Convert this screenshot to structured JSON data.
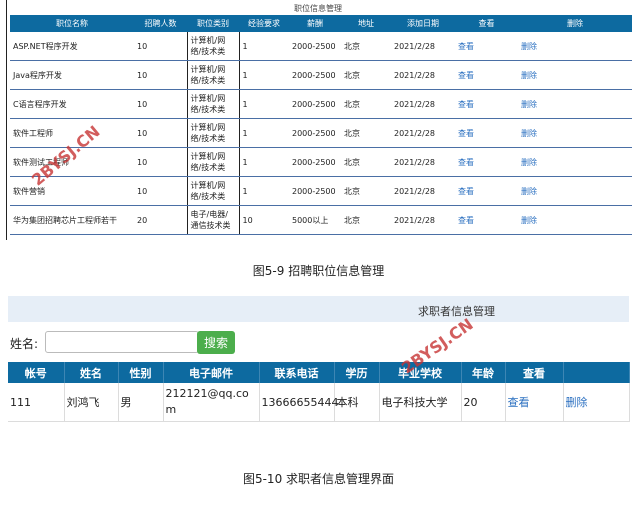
{
  "jobs": {
    "title": "职位信息管理",
    "headers": [
      "职位名称",
      "招聘人数",
      "职位类别",
      "经验要求",
      "薪酬",
      "地址",
      "添加日期",
      "查看",
      "删除"
    ],
    "rows": [
      [
        "ASP.NET程序开发",
        "10",
        "计算机/网络/技术类",
        "1",
        "2000-2500",
        "北京",
        "2021/2/28",
        "查看",
        "删除"
      ],
      [
        "Java程序开发",
        "10",
        "计算机/网络/技术类",
        "1",
        "2000-2500",
        "北京",
        "2021/2/28",
        "查看",
        "删除"
      ],
      [
        "C语言程序开发",
        "10",
        "计算机/网络/技术类",
        "1",
        "2000-2500",
        "北京",
        "2021/2/28",
        "查看",
        "删除"
      ],
      [
        "软件工程师",
        "10",
        "计算机/网络/技术类",
        "1",
        "2000-2500",
        "北京",
        "2021/2/28",
        "查看",
        "删除"
      ],
      [
        "软件测试工程师",
        "10",
        "计算机/网络/技术类",
        "1",
        "2000-2500",
        "北京",
        "2021/2/28",
        "查看",
        "删除"
      ],
      [
        "软件营销",
        "10",
        "计算机/网络/技术类",
        "1",
        "2000-2500",
        "北京",
        "2021/2/28",
        "查看",
        "删除"
      ],
      [
        "华为集团招聘芯片工程师若干",
        "20",
        "电子/电器/通信技术类",
        "10",
        "5000以上",
        "北京",
        "2021/2/28",
        "查看",
        "删除"
      ]
    ],
    "caption": "图5-9  招聘职位信息管理"
  },
  "applicants": {
    "title": "求职者信息管理",
    "search_label": "姓名:",
    "search_value": "",
    "search_button": "搜索",
    "headers": [
      "帐号",
      "姓名",
      "性别",
      "电子邮件",
      "联系电话",
      "学历",
      "毕业学校",
      "年龄",
      "查看",
      ""
    ],
    "rows": [
      [
        "111",
        "刘鸿飞",
        "男",
        "212121@qq.com",
        "13666655444",
        "本科",
        "电子科技大学",
        "20",
        "查看",
        "删除"
      ]
    ],
    "caption": "图5-10  求职者信息管理界面"
  },
  "watermark": "2BYSJ.CN"
}
